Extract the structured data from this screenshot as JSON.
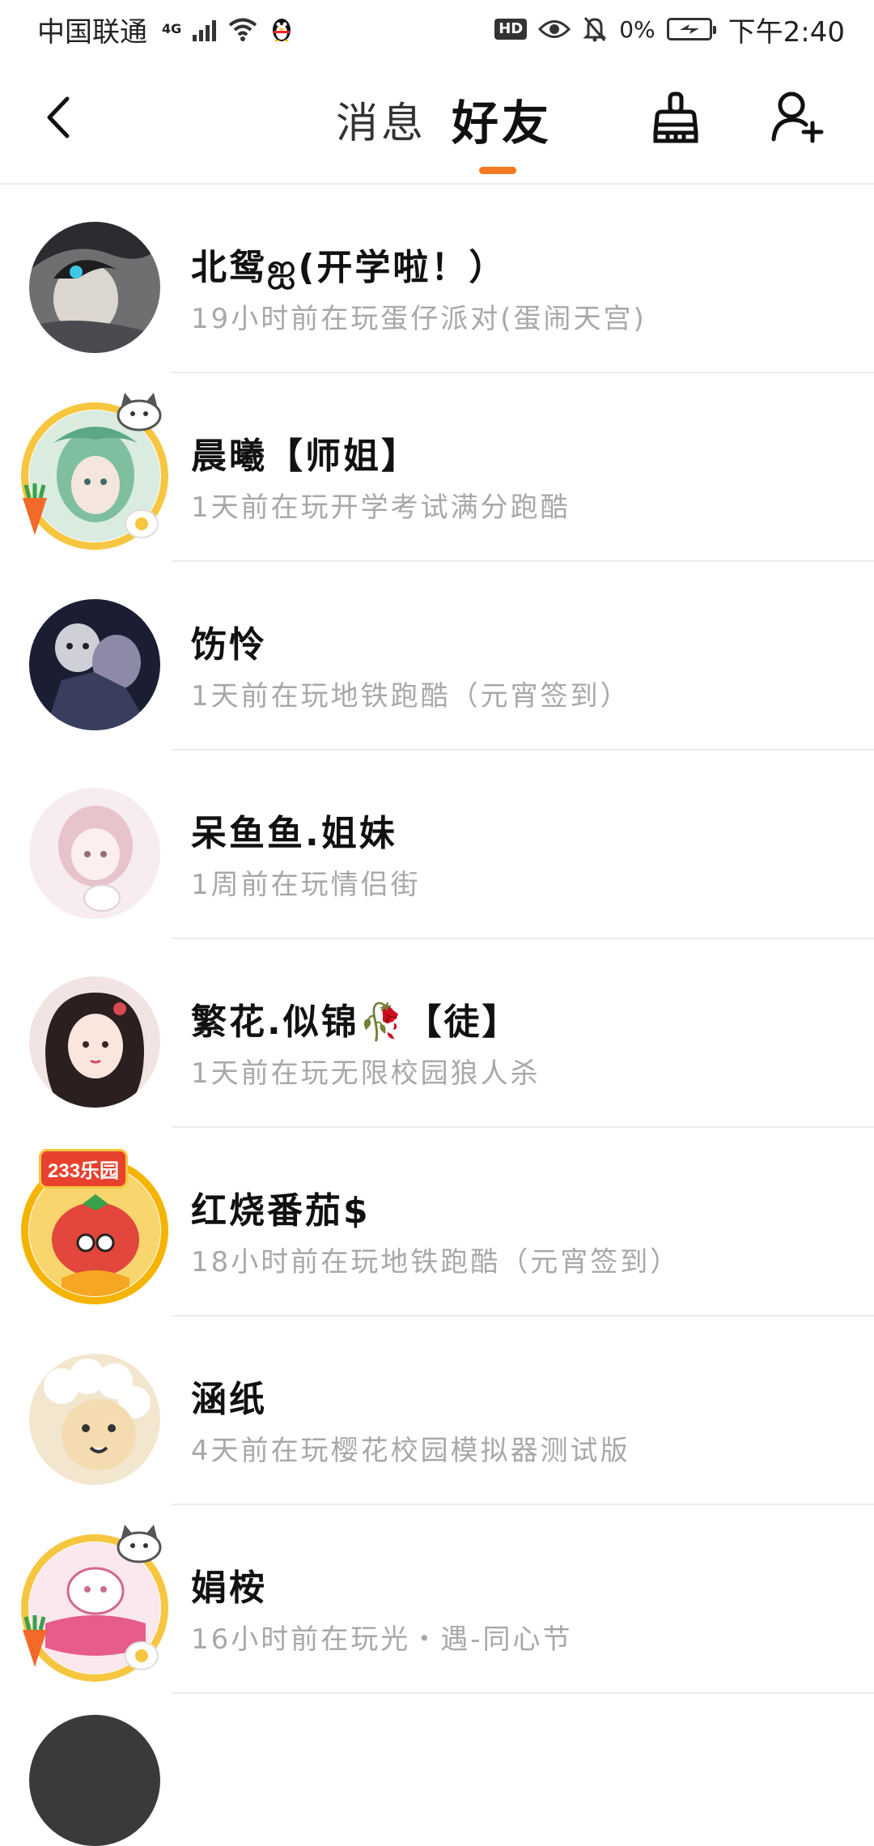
{
  "status_bar": {
    "carrier": "中国联通",
    "network": "4G",
    "battery_percent": "0%",
    "time": "下午2:40",
    "hd_label": "HD",
    "icons": [
      "signal-icon",
      "wifi-icon",
      "qq-penguin-icon",
      "hd-icon",
      "eye-icon",
      "mute-bell-icon",
      "battery-icon"
    ]
  },
  "nav": {
    "tabs": [
      {
        "label": "消息",
        "active": false
      },
      {
        "label": "好友",
        "active": true
      }
    ],
    "accent_color": "#f47a1f",
    "icons": [
      "back-arrow-icon",
      "broom-clean-icon",
      "add-friend-icon"
    ]
  },
  "friends": [
    {
      "name": "北鸳ஐ(开学啦！）",
      "status": "19小时前在玩蛋仔派对(蛋闹天宫)",
      "framed": false
    },
    {
      "name": "晨曦【师姐】",
      "status": "1天前在玩开学考试满分跑酷",
      "framed": true
    },
    {
      "name": "饬怜",
      "status": "1天前在玩地铁跑酷（元宵签到）",
      "framed": false
    },
    {
      "name": "呆鱼鱼.姐妹",
      "status": "1周前在玩情侣街",
      "framed": false
    },
    {
      "name": "繁花.似锦🥀【徒】",
      "status": "1天前在玩无限校园狼人杀",
      "framed": false
    },
    {
      "name": "红烧番茄$",
      "status": "18小时前在玩地铁跑酷（元宵签到）",
      "framed": true,
      "frame_text": "233乐园"
    },
    {
      "name": "涵纸",
      "status": "4天前在玩樱花校园模拟器测试版",
      "framed": false
    },
    {
      "name": "娟桉",
      "status": "16小时前在玩光・遇-同心节",
      "framed": true
    }
  ]
}
